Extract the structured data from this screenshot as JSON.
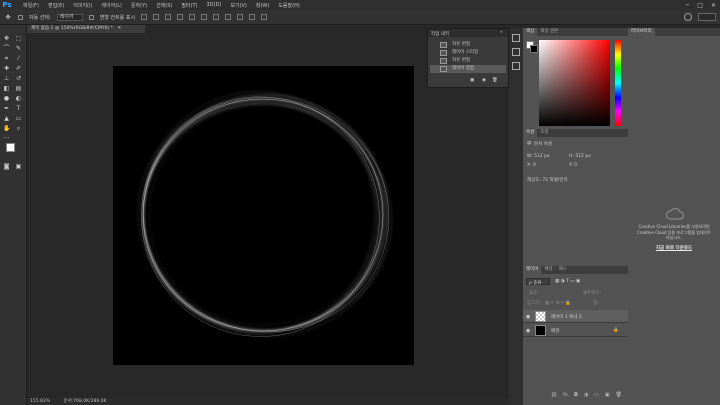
{
  "app": {
    "logo": "Ps"
  },
  "menu": [
    "파일(F)",
    "편집(E)",
    "이미지(I)",
    "레이어(L)",
    "문자(Y)",
    "선택(S)",
    "필터(T)",
    "3D(D)",
    "보기(V)",
    "창(W)",
    "도움말(H)"
  ],
  "window_controls": [
    "─",
    "□",
    "✕"
  ],
  "options": {
    "auto_select_label": "자동 선택:",
    "auto_select_value": "레이어",
    "transform_label": "변형 컨트롤 표시"
  },
  "document": {
    "tab_title": "제목 없음-1 @ 156%(RGB/8#/CMYK) *",
    "tab_close": "✕",
    "zoom": "155.83%",
    "doc_info": "문서:768.0K/289.0K"
  },
  "history": {
    "title": "작업 내역",
    "items": [
      "자유 변형",
      "레이어 스타일",
      "자유 변형",
      "레이어 병합"
    ]
  },
  "color_panel": {
    "tabs": [
      "색상",
      "색상 견본"
    ]
  },
  "properties": {
    "tabs": [
      "속성",
      "조정"
    ],
    "section": "문서 속성",
    "w": "W:  512 px",
    "h": "H:  512 px",
    "x": "X:  0",
    "y": "Y:  0",
    "resolution": "해상도: 72 픽셀/인치"
  },
  "libraries": {
    "title": "라이브러리",
    "message_1": "Creative Cloud Libraries를 사용하려면",
    "message_2": "Creative Cloud 응용 프로그램을 업데이트",
    "message_3": "하십시오.",
    "link": "지금 바로 다운로드"
  },
  "layers": {
    "tabs": [
      "레이어",
      "채널",
      "패스"
    ],
    "kind_label": "ρ 종류",
    "blend_label": "표준",
    "opacity_label": "불투명도:",
    "lock_label": "잠그기:",
    "fill_label": "칠:",
    "rows": [
      {
        "name": "레이어 1 복사 2"
      },
      {
        "name": "배경"
      }
    ]
  },
  "colors": {
    "accent": "#31a8ff",
    "canvas": "#000000"
  }
}
